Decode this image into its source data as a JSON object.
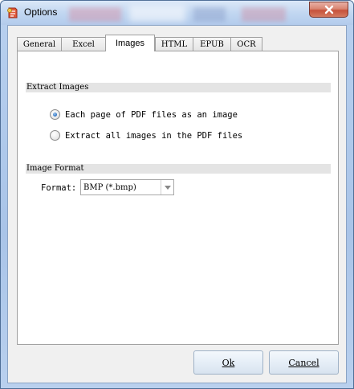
{
  "window": {
    "title": "Options"
  },
  "tabs": [
    {
      "label": "General"
    },
    {
      "label": "Excel"
    },
    {
      "label": "Images",
      "active": true
    },
    {
      "label": "HTML"
    },
    {
      "label": "EPUB"
    },
    {
      "label": "OCR"
    }
  ],
  "extract_images": {
    "header": "Extract Images",
    "options": [
      {
        "label": "Each page of PDF files as an image",
        "checked": true
      },
      {
        "label": "Extract all images in the PDF files",
        "checked": false
      }
    ]
  },
  "image_format": {
    "header": "Image Format",
    "format_label": "Format:",
    "selected_value": "BMP (*.bmp)"
  },
  "buttons": {
    "ok_label": "Ok",
    "cancel_label": "Cancel"
  },
  "colors": {
    "accent": "#2a6fc0",
    "close_button": "#c6523a"
  },
  "icons": {
    "app": "app-logo-icon",
    "close": "close-icon",
    "dropdown": "chevron-down-icon"
  }
}
